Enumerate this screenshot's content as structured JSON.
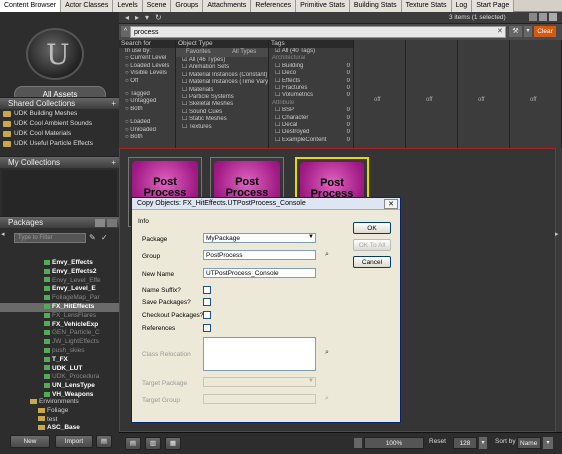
{
  "tabs": [
    "Content Browser",
    "Actor Classes",
    "Levels",
    "Scene",
    "Groups",
    "Attachments",
    "References",
    "Primitive Stats",
    "Building Stats",
    "Texture Stats",
    "Log",
    "Start Page"
  ],
  "toolbar": {
    "selection_count": "3 items (1 selected)",
    "search_value": "process",
    "clear_label": "Clear"
  },
  "sidebar": {
    "all_assets": "All Assets",
    "shared_collections_title": "Shared Collections",
    "shared_collections": [
      "UDK Building Meshes",
      "UDK Cool Ambient Sounds",
      "UDK Cool Materials",
      "UDK Useful Particle Effects"
    ],
    "my_collections_title": "My Collections",
    "packages_title": "Packages",
    "package_filter_placeholder": "Type to Filter",
    "packages": [
      {
        "name": "Envy_Effects",
        "style": "b"
      },
      {
        "name": "Envy_Effects2",
        "style": "b"
      },
      {
        "name": "Envy_Level_Effe",
        "style": "dim"
      },
      {
        "name": "Envy_Level_E",
        "style": "b"
      },
      {
        "name": "FoliageMap_Par",
        "style": "dim"
      },
      {
        "name": "FX_HitEffects",
        "style": "sel"
      },
      {
        "name": "FX_LensFlares",
        "style": "dim"
      },
      {
        "name": "FX_VehicleExp",
        "style": "b"
      },
      {
        "name": "GEN_Particle_C",
        "style": "dim"
      },
      {
        "name": "JW_LightEffects",
        "style": "dim"
      },
      {
        "name": "push_skies",
        "style": "dim"
      },
      {
        "name": "T_FX",
        "style": "b"
      },
      {
        "name": "UDK_LUT",
        "style": "b"
      },
      {
        "name": "UDK_Procedura",
        "style": "dim"
      },
      {
        "name": "UN_LensType",
        "style": "b"
      },
      {
        "name": "VH_Weapons",
        "style": "b"
      }
    ],
    "folders": [
      "Environments",
      "Foliage",
      "test",
      "ASC_Base"
    ],
    "new_label": "New",
    "import_label": "Import"
  },
  "filters": {
    "search_for": "Search for",
    "in_use_by": "In use by:",
    "use_options": [
      "Current Level",
      "Loaded Levels",
      "Visible Levels",
      "Off"
    ],
    "tag_options": [
      "Tagged",
      "Untagged",
      "Both"
    ],
    "load_options": [
      "Loaded",
      "Unloaded",
      "Both"
    ],
    "object_type_title": "Object Type",
    "favorites_label": "Favorites",
    "all_types_label": "All Types",
    "object_types": [
      "All (46 Types)",
      "Animation Sets",
      "Material Instances (Constant)",
      "Material Instances (Time Varyin",
      "Materials",
      "Particle Systems",
      "Skeletal Meshes",
      "Sound Cues",
      "Static Meshes",
      "Textures"
    ],
    "tags_title": "Tags",
    "tags": [
      {
        "name": "All (40 Tags)",
        "count": "",
        "header": false
      },
      {
        "name": "Architectural",
        "count": "",
        "header": true
      },
      {
        "name": "Building",
        "count": "0",
        "header": false
      },
      {
        "name": "Deco",
        "count": "0",
        "header": false
      },
      {
        "name": "Effects",
        "count": "0",
        "header": false
      },
      {
        "name": "Fractures",
        "count": "0",
        "header": false
      },
      {
        "name": "Volumetrics",
        "count": "0",
        "header": false
      },
      {
        "name": "Attribute",
        "count": "",
        "header": true
      },
      {
        "name": "BSP",
        "count": "0",
        "header": false
      },
      {
        "name": "Character",
        "count": "0",
        "header": false
      },
      {
        "name": "Decal",
        "count": "0",
        "header": false
      },
      {
        "name": "Destroyed",
        "count": "0",
        "header": false
      },
      {
        "name": "ExampleContent",
        "count": "0",
        "header": false
      }
    ],
    "off_labels": [
      "off",
      "off",
      "off",
      "off"
    ]
  },
  "assets": [
    {
      "line1": "Post",
      "line2": "Process"
    },
    {
      "line1": "Post",
      "line2": "Process"
    },
    {
      "line1": "Post",
      "line2": "Process"
    }
  ],
  "bottom": {
    "zoom": "100%",
    "reset": "Reset",
    "size": "128",
    "sort_by": "Sort by",
    "sort_value": "Name"
  },
  "dialog": {
    "title": "Copy Objects: FX_HitEffects.UTPostProcess_Console",
    "info_label": "Info",
    "package_label": "Package",
    "package_value": "MyPackage",
    "group_label": "Group",
    "group_value": "PostProcess",
    "new_name_label": "New Name",
    "new_name_value": "UTPostProcess_Console",
    "name_suffix_label": "Name Suffix?",
    "save_packages_label": "Save Packages?",
    "checkout_packages_label": "Checkout Packages?",
    "references_label": "References",
    "class_relocation_label": "Class Relocation",
    "target_package_label": "Target Package",
    "target_group_label": "Target Group",
    "ok_label": "OK",
    "ok_to_all_label": "OK To All",
    "cancel_label": "Cancel"
  }
}
